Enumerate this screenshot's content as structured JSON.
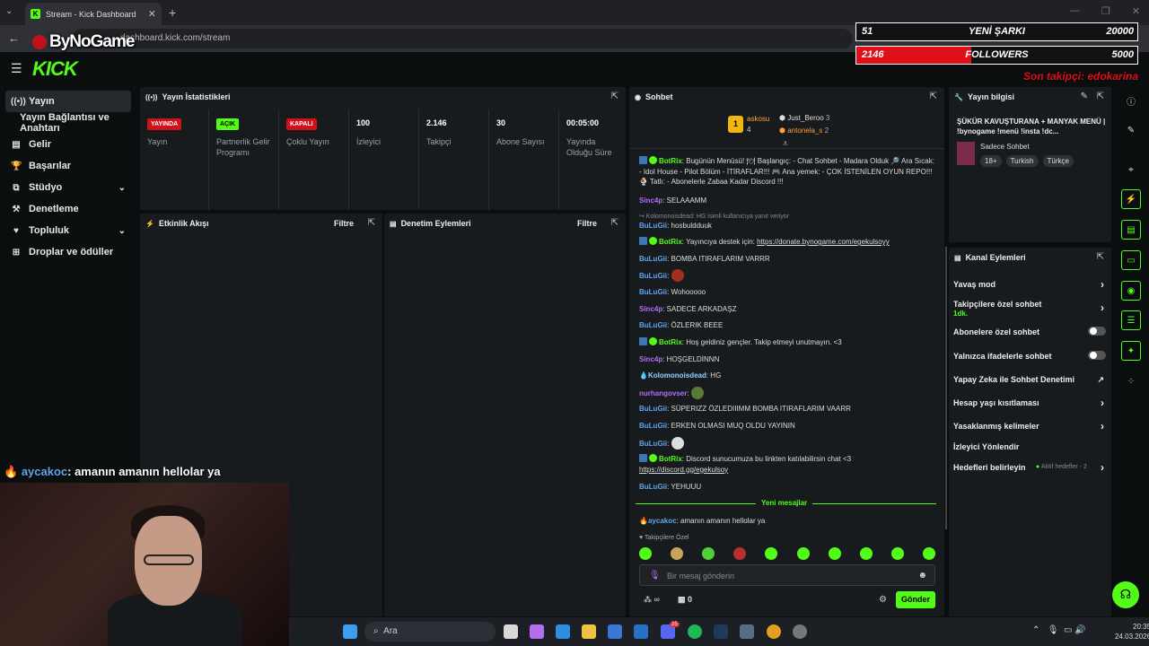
{
  "browser": {
    "tab_title": "Stream - Kick Dashboard",
    "url": "dashboard.kick.com/stream",
    "new_tab": "+",
    "close": "✕"
  },
  "overlay": {
    "logo": "ByNoGame",
    "song_count": "51",
    "song_label": "YENİ ŞARKI",
    "song_goal": "20000",
    "followers_count": "2146",
    "followers_label": "FOLLOWERS",
    "followers_goal": "5000",
    "followers_progress": 0.41,
    "last_follower": "Son takipçi: edokarina",
    "chat_user": "aycakoc",
    "chat_text": ": amanın amanın hellolar ya"
  },
  "nav": {
    "brand": "KICK"
  },
  "sidebar": {
    "items": [
      {
        "label": "Yayın",
        "icon": "broadcast-icon"
      },
      {
        "label": "Yayın Bağlantısı ve Anahtarı",
        "icon": ""
      },
      {
        "label": "Gelir",
        "icon": "money-icon"
      },
      {
        "label": "Başarılar",
        "icon": "trophy-icon"
      },
      {
        "label": "Stüdyo",
        "icon": "studio-icon"
      },
      {
        "label": "Denetleme",
        "icon": "hammer-icon"
      },
      {
        "label": "Topluluk",
        "icon": "community-icon"
      },
      {
        "label": "Droplar ve ödüller",
        "icon": "gift-icon"
      }
    ]
  },
  "stats": {
    "title": "Yayın İstatistikleri",
    "items": [
      {
        "badge": "YAYINDA",
        "label": "Yayın",
        "color": "#d0101a"
      },
      {
        "badge": "AÇIK",
        "label": "Partnerlik Gelir Programı",
        "color": "#53fc18"
      },
      {
        "badge": "KAPALI",
        "label": "Çoklu Yayın",
        "color": "#d0101a"
      },
      {
        "value": "100",
        "label": "İzleyici"
      },
      {
        "value": "2.146",
        "label": "Takipçi"
      },
      {
        "value": "30",
        "label": "Abone Sayısı"
      },
      {
        "value": "00:05:00",
        "label": "Yayında Olduğu Süre"
      }
    ]
  },
  "activity": {
    "title": "Etkinlik Akışı",
    "filter": "Filtre"
  },
  "moderation": {
    "title": "Denetim Eylemleri",
    "filter": "Filtre"
  },
  "chat": {
    "title": "Sohbet",
    "top": {
      "rank": "1",
      "user1": "askosu",
      "user1_val": "4",
      "user2": "Just_Beroo",
      "user2_val": "3",
      "user3": "antonela_s",
      "user3_val": "2"
    },
    "messages": [
      {
        "user": "BotRix",
        "text": ": Bugünün Menüsü! 🍽 Başlangıç: - Chat Sohbet - Madara Olduk 🔎 Ara Sıcak: - Idol House - Pilot Bölüm - İTİRAFLAR!!! 🎮 Ana yemek: - ÇOK İSTENİLEN OYUN REPO!!! 🍨 Tatlı: - Abonelerle Zabaa Kadar Discord !!!"
      },
      {
        "user": "Sinc4p",
        "text": ": SELAAAMM"
      },
      {
        "reply": "↪ Kolomonoisdead: HG isimli kullanıcıya yanıt veriyor"
      },
      {
        "user": "BuLuGii",
        "text": ": hosbuldduuk"
      },
      {
        "user": "BotRix",
        "text": ": Yayıncıya destek için: ",
        "link": "https://donate.bynogame.com/egekulsoyy"
      },
      {
        "user": "BuLuGii",
        "text": ": BOMBA ITIRAFLARIM VARRR"
      },
      {
        "user": "BuLuGii",
        "text": ":"
      },
      {
        "user": "BuLuGii",
        "text": ": Wohooooo"
      },
      {
        "user": "Sinc4p",
        "text": ": SADECE ARKADAŞZ"
      },
      {
        "user": "BuLuGii",
        "text": ": ÖZLERIK BEEE"
      },
      {
        "user": "BotRix",
        "text": ": Hoş geldiniz gençler. Takip etmeyi unutmayın. <3"
      },
      {
        "user": "Sinc4p",
        "text": ": HOŞGELDİNNN"
      },
      {
        "user": "Kolomonoisdead",
        "text": ": HG"
      },
      {
        "user": "nurhangovser",
        "text": ":"
      },
      {
        "user": "BuLuGii",
        "text": ": SÜPERIZZ ÖZLEDIIIMM BOMBA ITIRAFLARIM VAARR"
      },
      {
        "user": "BuLuGii",
        "text": ": ERKEN OLMASI MUQ OLDU YAYININ"
      },
      {
        "user": "BuLuGii",
        "text": ":"
      },
      {
        "user": "BotRix",
        "text": ": Discord sunucumuza bu linkten katılabilirsin chat <3 ",
        "link": "https://discord.gg/egekulsoy"
      },
      {
        "user": "BuLuGii",
        "text": ": YEHUUU"
      }
    ],
    "new_messages": "Yeni mesajlar",
    "last": {
      "user": "aycakoc",
      "text": ": amanın amanın hellolar ya"
    },
    "followers_only": "Takipçilere Özel",
    "input_placeholder": "Bir mesaj gönderin",
    "points": "∞",
    "gift_count": "0",
    "send": "Gönder"
  },
  "info": {
    "title": "Yayın bilgisi",
    "stream_title": "ŞÜKÜR KAVUŞTURANA + MANYAK MENÜ | !bynogame !menü !insta !dc...",
    "category": "Sadece Sohbet",
    "tags": [
      "18+",
      "Turkish",
      "Türkçe"
    ]
  },
  "actions": {
    "title": "Kanal Eylemleri",
    "items": [
      {
        "label": "Yavaş mod",
        "kind": "arrow"
      },
      {
        "label": "Takipçilere özel sohbet",
        "sub": "1dk.",
        "kind": "arrow"
      },
      {
        "label": "Abonelere özel sohbet",
        "kind": "toggle"
      },
      {
        "label": "Yalnızca ifadelerle sohbet",
        "kind": "toggle"
      },
      {
        "label": "Yapay Zeka ile Sohbet Denetimi",
        "kind": "ext"
      },
      {
        "label": "Hesap yaşı kısıtlaması",
        "kind": "arrow"
      },
      {
        "label": "Yasaklanmış kelimeler",
        "kind": "arrow"
      },
      {
        "label": "İzleyici Yönlendir",
        "kind": "none"
      },
      {
        "label": "Hedefleri belirleyin",
        "note": "Aktif hedefler - 2",
        "kind": "arrow"
      }
    ]
  },
  "taskbar": {
    "search": "Ara",
    "time": "20:35",
    "date": "24.03.2026",
    "badge": "25"
  },
  "colors": {
    "kick_green": "#53fc18",
    "live_red": "#d0101a",
    "panel": "#181b1d"
  }
}
